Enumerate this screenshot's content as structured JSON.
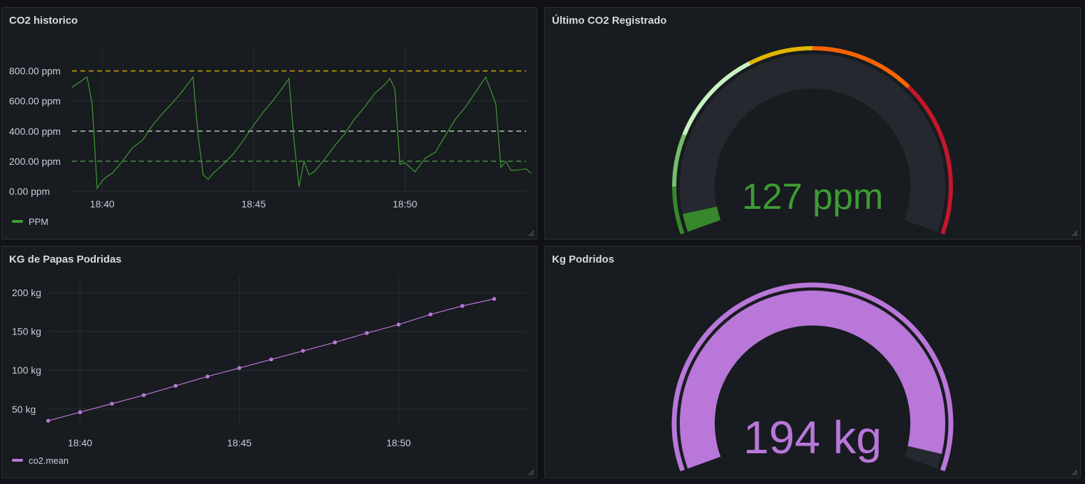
{
  "panels": {
    "co2_history": {
      "title": "CO2 historico",
      "legend": "PPM",
      "y_ticks": [
        "0.00 ppm",
        "200.00 ppm",
        "400.00 ppm",
        "600.00 ppm",
        "800.00 ppm"
      ],
      "x_ticks": [
        "18:40",
        "18:45",
        "18:50"
      ]
    },
    "last_co2": {
      "title": "Último CO2 Registrado",
      "value": 127,
      "unit": "ppm",
      "display": "127 ppm"
    },
    "kg_history": {
      "title": "KG de Papas Podridas",
      "legend": "co2.mean",
      "y_ticks": [
        "50 kg",
        "100 kg",
        "150 kg",
        "200 kg"
      ],
      "x_ticks": [
        "18:40",
        "18:45",
        "18:50"
      ]
    },
    "kg_total": {
      "title": "Kg Podridos",
      "value": 194,
      "unit": "kg",
      "display": "194 kg"
    }
  },
  "colors": {
    "co2_series": "#3d9c34",
    "kg_series": "#b877d9",
    "threshold_800": "#e0b400",
    "threshold_400": "#c8f2c2",
    "threshold_200": "#56a64b",
    "gauge_track": "#25282e"
  },
  "chart_data": [
    {
      "type": "line",
      "title": "CO2 historico",
      "xlabel": "",
      "ylabel": "",
      "ylim": [
        0,
        900
      ],
      "x_range": [
        "18:39",
        "18:54"
      ],
      "grid": true,
      "legend_position": "bottom-left",
      "thresholds": [
        200,
        400,
        800
      ],
      "series": [
        {
          "name": "PPM",
          "color": "#3d9c34",
          "x": [
            "18:39:00",
            "18:39:30",
            "18:39:40",
            "18:39:50",
            "18:40:00",
            "18:40:10",
            "18:40:20",
            "18:40:40",
            "18:41:00",
            "18:41:20",
            "18:41:40",
            "18:42:00",
            "18:42:20",
            "18:42:40",
            "18:43:00",
            "18:43:10",
            "18:43:20",
            "18:43:30",
            "18:43:40",
            "18:44:00",
            "18:44:20",
            "18:44:40",
            "18:45:00",
            "18:45:20",
            "18:45:40",
            "18:46:00",
            "18:46:10",
            "18:46:20",
            "18:46:30",
            "18:46:40",
            "18:46:50",
            "18:47:00",
            "18:47:20",
            "18:47:40",
            "18:48:00",
            "18:48:20",
            "18:48:40",
            "18:49:00",
            "18:49:20",
            "18:49:30",
            "18:49:40",
            "18:49:50",
            "18:50:00",
            "18:50:10",
            "18:50:20",
            "18:50:40",
            "18:51:00",
            "18:51:20",
            "18:51:40",
            "18:52:00",
            "18:52:20",
            "18:52:40",
            "18:53:00",
            "18:53:10",
            "18:53:20",
            "18:53:30",
            "18:53:40",
            "18:54:00",
            "18:54:10"
          ],
          "values": [
            690,
            760,
            580,
            20,
            70,
            100,
            120,
            200,
            290,
            340,
            440,
            520,
            590,
            670,
            760,
            370,
            110,
            80,
            120,
            180,
            250,
            340,
            440,
            530,
            610,
            700,
            750,
            340,
            30,
            200,
            110,
            130,
            210,
            300,
            380,
            480,
            560,
            650,
            710,
            750,
            680,
            180,
            190,
            160,
            130,
            220,
            260,
            370,
            480,
            560,
            660,
            760,
            580,
            160,
            200,
            140,
            140,
            150,
            120
          ]
        }
      ]
    },
    {
      "type": "line",
      "title": "KG de Papas Podridas",
      "xlabel": "",
      "ylabel": "",
      "ylim": [
        30,
        210
      ],
      "x_range": [
        "18:39",
        "18:54"
      ],
      "grid": true,
      "legend_position": "bottom-left",
      "series": [
        {
          "name": "co2.mean",
          "color": "#b877d9",
          "x": [
            "18:39",
            "18:40",
            "18:41",
            "18:42",
            "18:43",
            "18:44",
            "18:45",
            "18:46",
            "18:47",
            "18:48",
            "18:49",
            "18:50",
            "18:51",
            "18:52",
            "18:53"
          ],
          "values": [
            35,
            46,
            57,
            68,
            80,
            92,
            103,
            114,
            125,
            136,
            148,
            159,
            172,
            183,
            192
          ]
        }
      ]
    }
  ]
}
